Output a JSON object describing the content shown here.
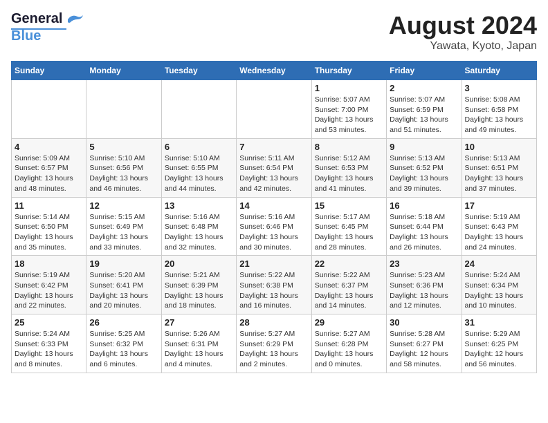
{
  "header": {
    "logo_general": "General",
    "logo_blue": "Blue",
    "title": "August 2024",
    "subtitle": "Yawata, Kyoto, Japan"
  },
  "days_of_week": [
    "Sunday",
    "Monday",
    "Tuesday",
    "Wednesday",
    "Thursday",
    "Friday",
    "Saturday"
  ],
  "weeks": [
    [
      {
        "day": "",
        "info": ""
      },
      {
        "day": "",
        "info": ""
      },
      {
        "day": "",
        "info": ""
      },
      {
        "day": "",
        "info": ""
      },
      {
        "day": "1",
        "info": "Sunrise: 5:07 AM\nSunset: 7:00 PM\nDaylight: 13 hours\nand 53 minutes."
      },
      {
        "day": "2",
        "info": "Sunrise: 5:07 AM\nSunset: 6:59 PM\nDaylight: 13 hours\nand 51 minutes."
      },
      {
        "day": "3",
        "info": "Sunrise: 5:08 AM\nSunset: 6:58 PM\nDaylight: 13 hours\nand 49 minutes."
      }
    ],
    [
      {
        "day": "4",
        "info": "Sunrise: 5:09 AM\nSunset: 6:57 PM\nDaylight: 13 hours\nand 48 minutes."
      },
      {
        "day": "5",
        "info": "Sunrise: 5:10 AM\nSunset: 6:56 PM\nDaylight: 13 hours\nand 46 minutes."
      },
      {
        "day": "6",
        "info": "Sunrise: 5:10 AM\nSunset: 6:55 PM\nDaylight: 13 hours\nand 44 minutes."
      },
      {
        "day": "7",
        "info": "Sunrise: 5:11 AM\nSunset: 6:54 PM\nDaylight: 13 hours\nand 42 minutes."
      },
      {
        "day": "8",
        "info": "Sunrise: 5:12 AM\nSunset: 6:53 PM\nDaylight: 13 hours\nand 41 minutes."
      },
      {
        "day": "9",
        "info": "Sunrise: 5:13 AM\nSunset: 6:52 PM\nDaylight: 13 hours\nand 39 minutes."
      },
      {
        "day": "10",
        "info": "Sunrise: 5:13 AM\nSunset: 6:51 PM\nDaylight: 13 hours\nand 37 minutes."
      }
    ],
    [
      {
        "day": "11",
        "info": "Sunrise: 5:14 AM\nSunset: 6:50 PM\nDaylight: 13 hours\nand 35 minutes."
      },
      {
        "day": "12",
        "info": "Sunrise: 5:15 AM\nSunset: 6:49 PM\nDaylight: 13 hours\nand 33 minutes."
      },
      {
        "day": "13",
        "info": "Sunrise: 5:16 AM\nSunset: 6:48 PM\nDaylight: 13 hours\nand 32 minutes."
      },
      {
        "day": "14",
        "info": "Sunrise: 5:16 AM\nSunset: 6:46 PM\nDaylight: 13 hours\nand 30 minutes."
      },
      {
        "day": "15",
        "info": "Sunrise: 5:17 AM\nSunset: 6:45 PM\nDaylight: 13 hours\nand 28 minutes."
      },
      {
        "day": "16",
        "info": "Sunrise: 5:18 AM\nSunset: 6:44 PM\nDaylight: 13 hours\nand 26 minutes."
      },
      {
        "day": "17",
        "info": "Sunrise: 5:19 AM\nSunset: 6:43 PM\nDaylight: 13 hours\nand 24 minutes."
      }
    ],
    [
      {
        "day": "18",
        "info": "Sunrise: 5:19 AM\nSunset: 6:42 PM\nDaylight: 13 hours\nand 22 minutes."
      },
      {
        "day": "19",
        "info": "Sunrise: 5:20 AM\nSunset: 6:41 PM\nDaylight: 13 hours\nand 20 minutes."
      },
      {
        "day": "20",
        "info": "Sunrise: 5:21 AM\nSunset: 6:39 PM\nDaylight: 13 hours\nand 18 minutes."
      },
      {
        "day": "21",
        "info": "Sunrise: 5:22 AM\nSunset: 6:38 PM\nDaylight: 13 hours\nand 16 minutes."
      },
      {
        "day": "22",
        "info": "Sunrise: 5:22 AM\nSunset: 6:37 PM\nDaylight: 13 hours\nand 14 minutes."
      },
      {
        "day": "23",
        "info": "Sunrise: 5:23 AM\nSunset: 6:36 PM\nDaylight: 13 hours\nand 12 minutes."
      },
      {
        "day": "24",
        "info": "Sunrise: 5:24 AM\nSunset: 6:34 PM\nDaylight: 13 hours\nand 10 minutes."
      }
    ],
    [
      {
        "day": "25",
        "info": "Sunrise: 5:24 AM\nSunset: 6:33 PM\nDaylight: 13 hours\nand 8 minutes."
      },
      {
        "day": "26",
        "info": "Sunrise: 5:25 AM\nSunset: 6:32 PM\nDaylight: 13 hours\nand 6 minutes."
      },
      {
        "day": "27",
        "info": "Sunrise: 5:26 AM\nSunset: 6:31 PM\nDaylight: 13 hours\nand 4 minutes."
      },
      {
        "day": "28",
        "info": "Sunrise: 5:27 AM\nSunset: 6:29 PM\nDaylight: 13 hours\nand 2 minutes."
      },
      {
        "day": "29",
        "info": "Sunrise: 5:27 AM\nSunset: 6:28 PM\nDaylight: 13 hours\nand 0 minutes."
      },
      {
        "day": "30",
        "info": "Sunrise: 5:28 AM\nSunset: 6:27 PM\nDaylight: 12 hours\nand 58 minutes."
      },
      {
        "day": "31",
        "info": "Sunrise: 5:29 AM\nSunset: 6:25 PM\nDaylight: 12 hours\nand 56 minutes."
      }
    ]
  ]
}
